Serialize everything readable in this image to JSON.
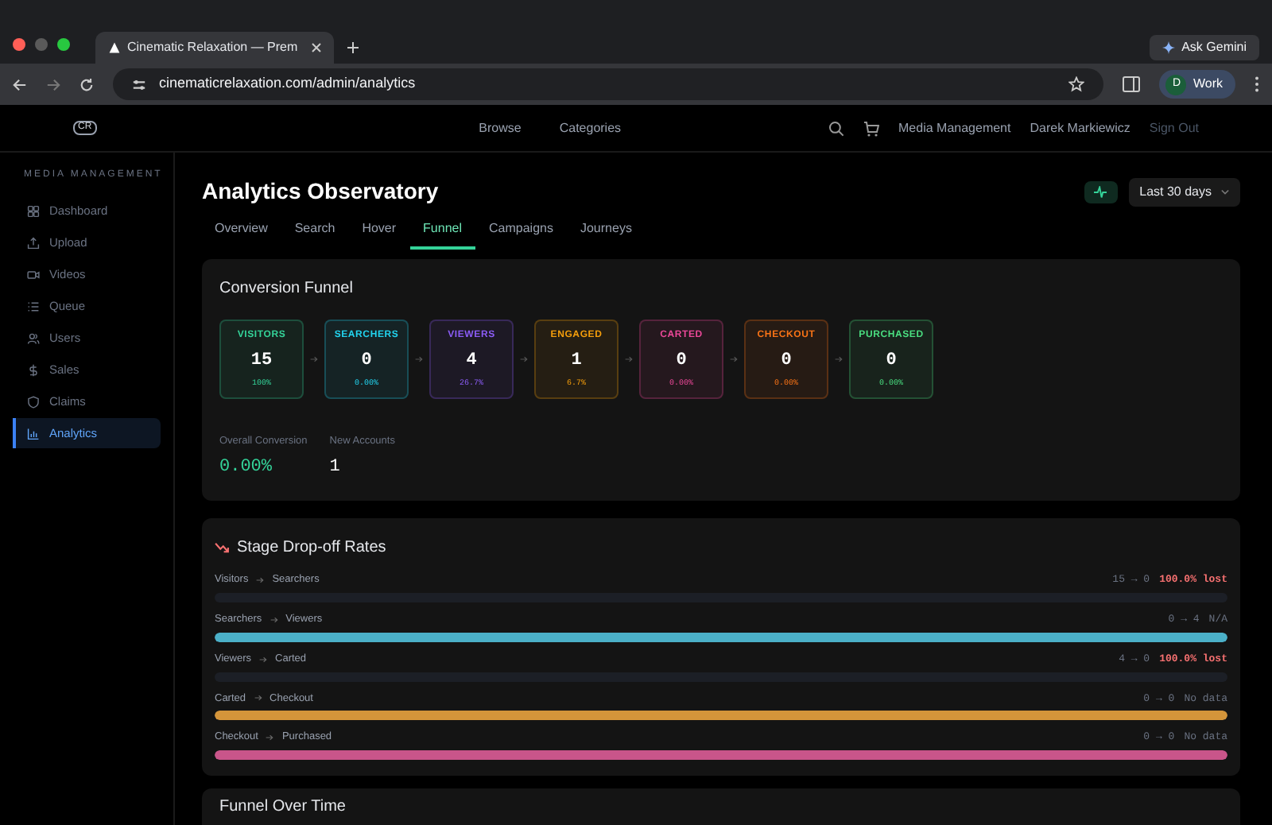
{
  "browser": {
    "tab_title": "Cinematic Relaxation — Prem",
    "url": "cinematicrelaxation.com/admin/analytics",
    "ask_button": "Ask Gemini",
    "profile": {
      "initial": "D",
      "label": "Work"
    }
  },
  "site_nav": {
    "logo": "CR",
    "links": [
      "Browse",
      "Categories"
    ],
    "right_links": [
      "Media Management",
      "Darek Markiewicz",
      "Sign Out"
    ]
  },
  "sidebar": {
    "heading": "MEDIA MANAGEMENT",
    "items": [
      {
        "label": "Dashboard",
        "selected": false
      },
      {
        "label": "Upload",
        "selected": false
      },
      {
        "label": "Videos",
        "selected": false
      },
      {
        "label": "Queue",
        "selected": false
      },
      {
        "label": "Users",
        "selected": false
      },
      {
        "label": "Sales",
        "selected": false
      },
      {
        "label": "Claims",
        "selected": false
      },
      {
        "label": "Analytics",
        "selected": true
      }
    ]
  },
  "page": {
    "title": "Analytics Observatory",
    "range": "Last 30 days"
  },
  "tabs": [
    {
      "label": "Overview",
      "selected": false
    },
    {
      "label": "Search",
      "selected": false
    },
    {
      "label": "Hover",
      "selected": false
    },
    {
      "label": "Funnel",
      "selected": true
    },
    {
      "label": "Campaigns",
      "selected": false
    },
    {
      "label": "Journeys",
      "selected": false
    }
  ],
  "funnel": {
    "title": "Conversion Funnel",
    "stages": [
      {
        "label": "VISITORS",
        "value": "15",
        "percent": "100%",
        "color": "#34d399"
      },
      {
        "label": "SEARCHERS",
        "value": "0",
        "percent": "0.00%",
        "color": "#22d3ee"
      },
      {
        "label": "VIEWERS",
        "value": "4",
        "percent": "26.7%",
        "color": "#8b5cf6"
      },
      {
        "label": "ENGAGED",
        "value": "1",
        "percent": "6.7%",
        "color": "#f59e0b"
      },
      {
        "label": "CARTED",
        "value": "0",
        "percent": "0.00%",
        "color": "#ec4899"
      },
      {
        "label": "CHECKOUT",
        "value": "0",
        "percent": "0.00%",
        "color": "#f97316"
      },
      {
        "label": "PURCHASED",
        "value": "0",
        "percent": "0.00%",
        "color": "#4ade80"
      }
    ],
    "stats": [
      {
        "label": "Overall Conversion",
        "value": "0.00%",
        "kind": "accent"
      },
      {
        "label": "New Accounts",
        "value": "1",
        "kind": "plain"
      }
    ]
  },
  "dropoff": {
    "title": "Stage Drop-off Rates",
    "rows": [
      {
        "from": "Visitors",
        "to": "Searchers",
        "counts": "15 → 0",
        "status": "100.0% lost",
        "kind": "lost"
      },
      {
        "from": "Searchers",
        "to": "Viewers",
        "counts": "0 → 4",
        "status": "N/A",
        "kind": "neutral",
        "level": 1,
        "color": "#4bb0c8"
      },
      {
        "from": "Viewers",
        "to": "Carted",
        "counts": "4 → 0",
        "status": "100.0% lost",
        "kind": "lost"
      },
      {
        "from": "Carted",
        "to": "Checkout",
        "counts": "0 → 0",
        "status": "No data",
        "kind": "neutral",
        "level": 1,
        "color": "#d4953a"
      },
      {
        "from": "Checkout",
        "to": "Purchased",
        "counts": "0 → 0",
        "status": "No data",
        "kind": "neutral",
        "level": 1,
        "color": "#c9558a"
      }
    ]
  },
  "next_section": {
    "title": "Funnel Over Time"
  }
}
